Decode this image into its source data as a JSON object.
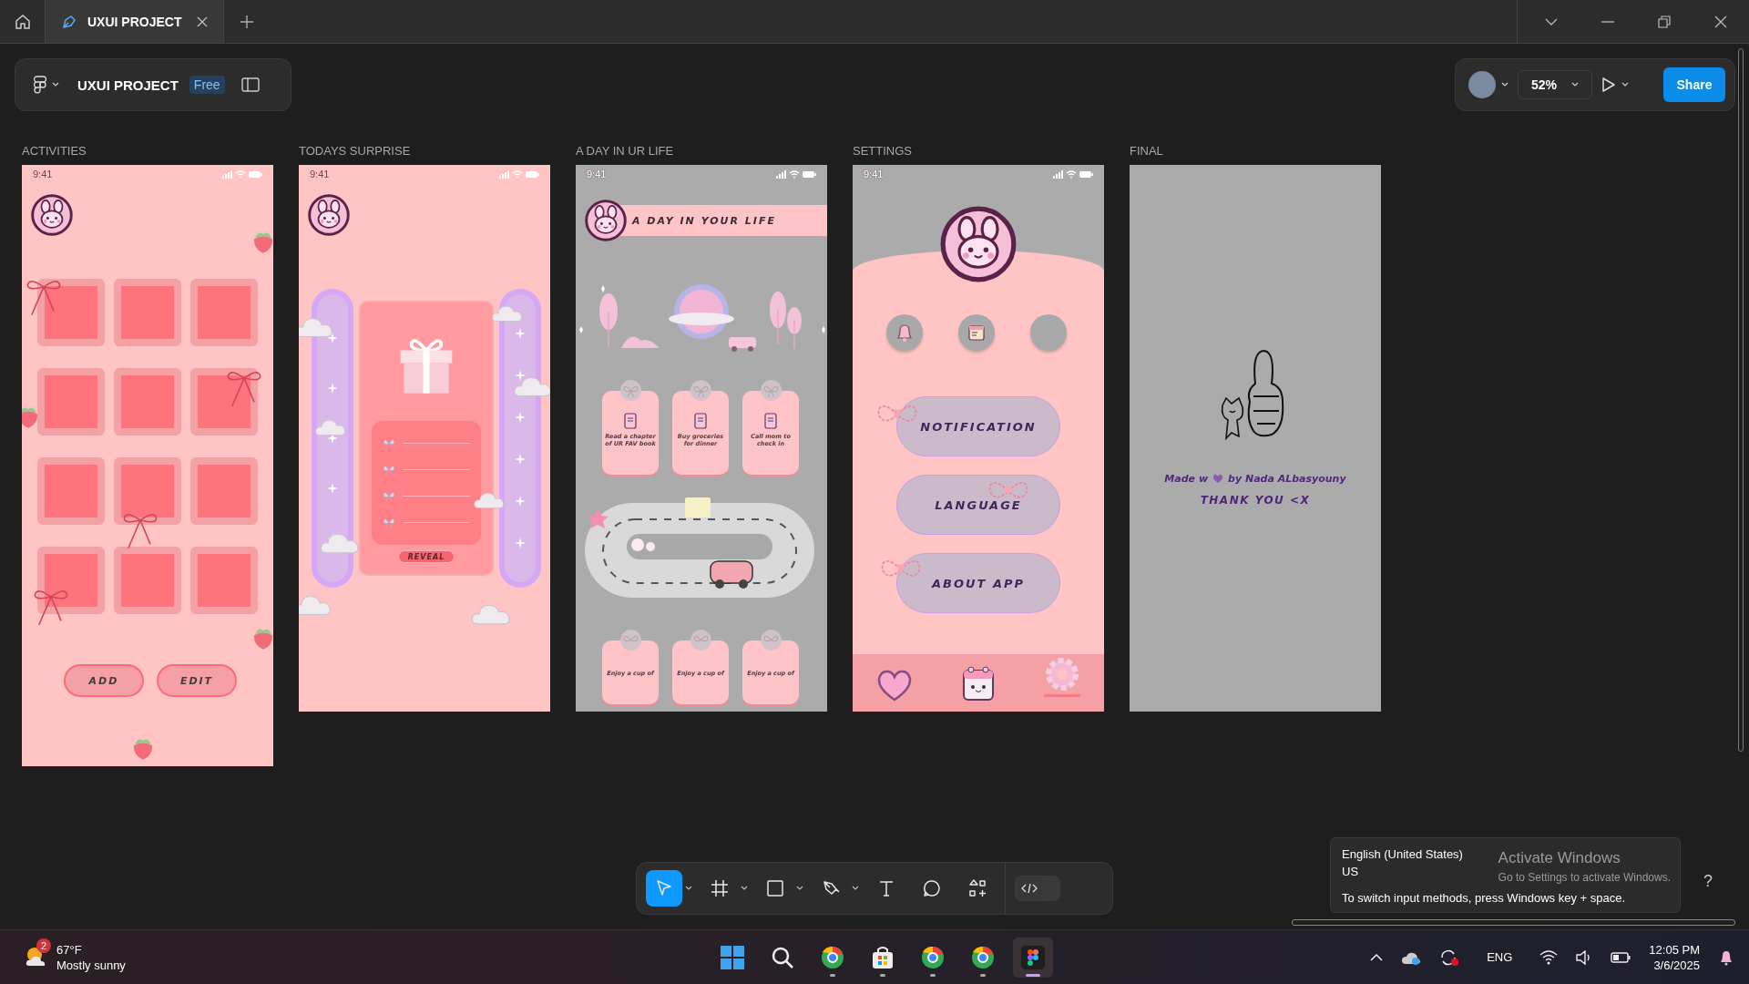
{
  "title_bar": {
    "tabs": [
      {
        "label": "UXUI PROJECT",
        "selected": true
      }
    ]
  },
  "file_panel": {
    "name": "UXUI PROJECT",
    "plan": "Free"
  },
  "view_panel": {
    "zoom": "52%",
    "share": "Share"
  },
  "frames": [
    {
      "kind": "activities",
      "title": "ACTIVITIES",
      "time": "9:41",
      "buttons": [
        "ADD",
        "EDIT"
      ]
    },
    {
      "kind": "surprise",
      "title": "TODAYS SURPRISE",
      "time": "9:41",
      "button": "REVEAL"
    },
    {
      "kind": "day",
      "title": "A DAY IN UR LIFE",
      "time": "9:41",
      "heading": "A DAY IN YOUR LIFE",
      "tasks": [
        "Read a chapter of UR FAV book",
        "Buy groceries for dinner",
        "Call mom to check in"
      ],
      "more_tasks": [
        "Enjoy a cup of",
        "Enjoy a cup of",
        "Enjoy a cup of"
      ]
    },
    {
      "kind": "settings",
      "title": "SETTINGS",
      "time": "9:41",
      "buttons": [
        "NOTIFICATION",
        "LANGUAGE",
        "ABOUT APP"
      ],
      "nav": [
        {
          "kind": "heart",
          "selected": false
        },
        {
          "kind": "calendar",
          "selected": false
        },
        {
          "kind": "gear",
          "selected": true
        }
      ]
    },
    {
      "kind": "final",
      "title": "FINAL",
      "credit_before": "Made w",
      "credit_after": "by Nada ALbasyouny",
      "thanks": "THANK YOU <X"
    }
  ],
  "tools": [
    {
      "kind": "move",
      "selected": true,
      "menu": true
    },
    {
      "kind": "frame",
      "selected": false,
      "menu": true
    },
    {
      "kind": "shape",
      "selected": false,
      "menu": true
    },
    {
      "kind": "pen",
      "selected": false,
      "menu": true
    },
    {
      "kind": "text",
      "selected": false,
      "menu": false
    },
    {
      "kind": "comment",
      "selected": false,
      "menu": false
    },
    {
      "kind": "actions",
      "selected": false,
      "menu": false
    }
  ],
  "dev_mode": {
    "on": false
  },
  "input_tooltip": {
    "language": "English (United States)",
    "layout": "US",
    "hint": "To switch input methods, press Windows key + space."
  },
  "activation": {
    "title": "Activate Windows",
    "hint": "Go to Settings to activate Windows."
  },
  "help": "?",
  "taskbar": {
    "weather": {
      "temperature": "67°F",
      "condition": "Mostly sunny",
      "badge": "2"
    },
    "apps": [
      {
        "kind": "start",
        "running": false,
        "selected": false
      },
      {
        "kind": "search",
        "running": false,
        "selected": false
      },
      {
        "kind": "browser",
        "running": true,
        "selected": false
      },
      {
        "kind": "store",
        "running": true,
        "selected": false
      },
      {
        "kind": "browser",
        "running": true,
        "selected": false
      },
      {
        "kind": "browser",
        "running": true,
        "selected": false
      },
      {
        "kind": "figma",
        "running": true,
        "selected": true
      }
    ],
    "language": "ENG",
    "time": "12:05 PM",
    "date": "3/6/2025"
  }
}
